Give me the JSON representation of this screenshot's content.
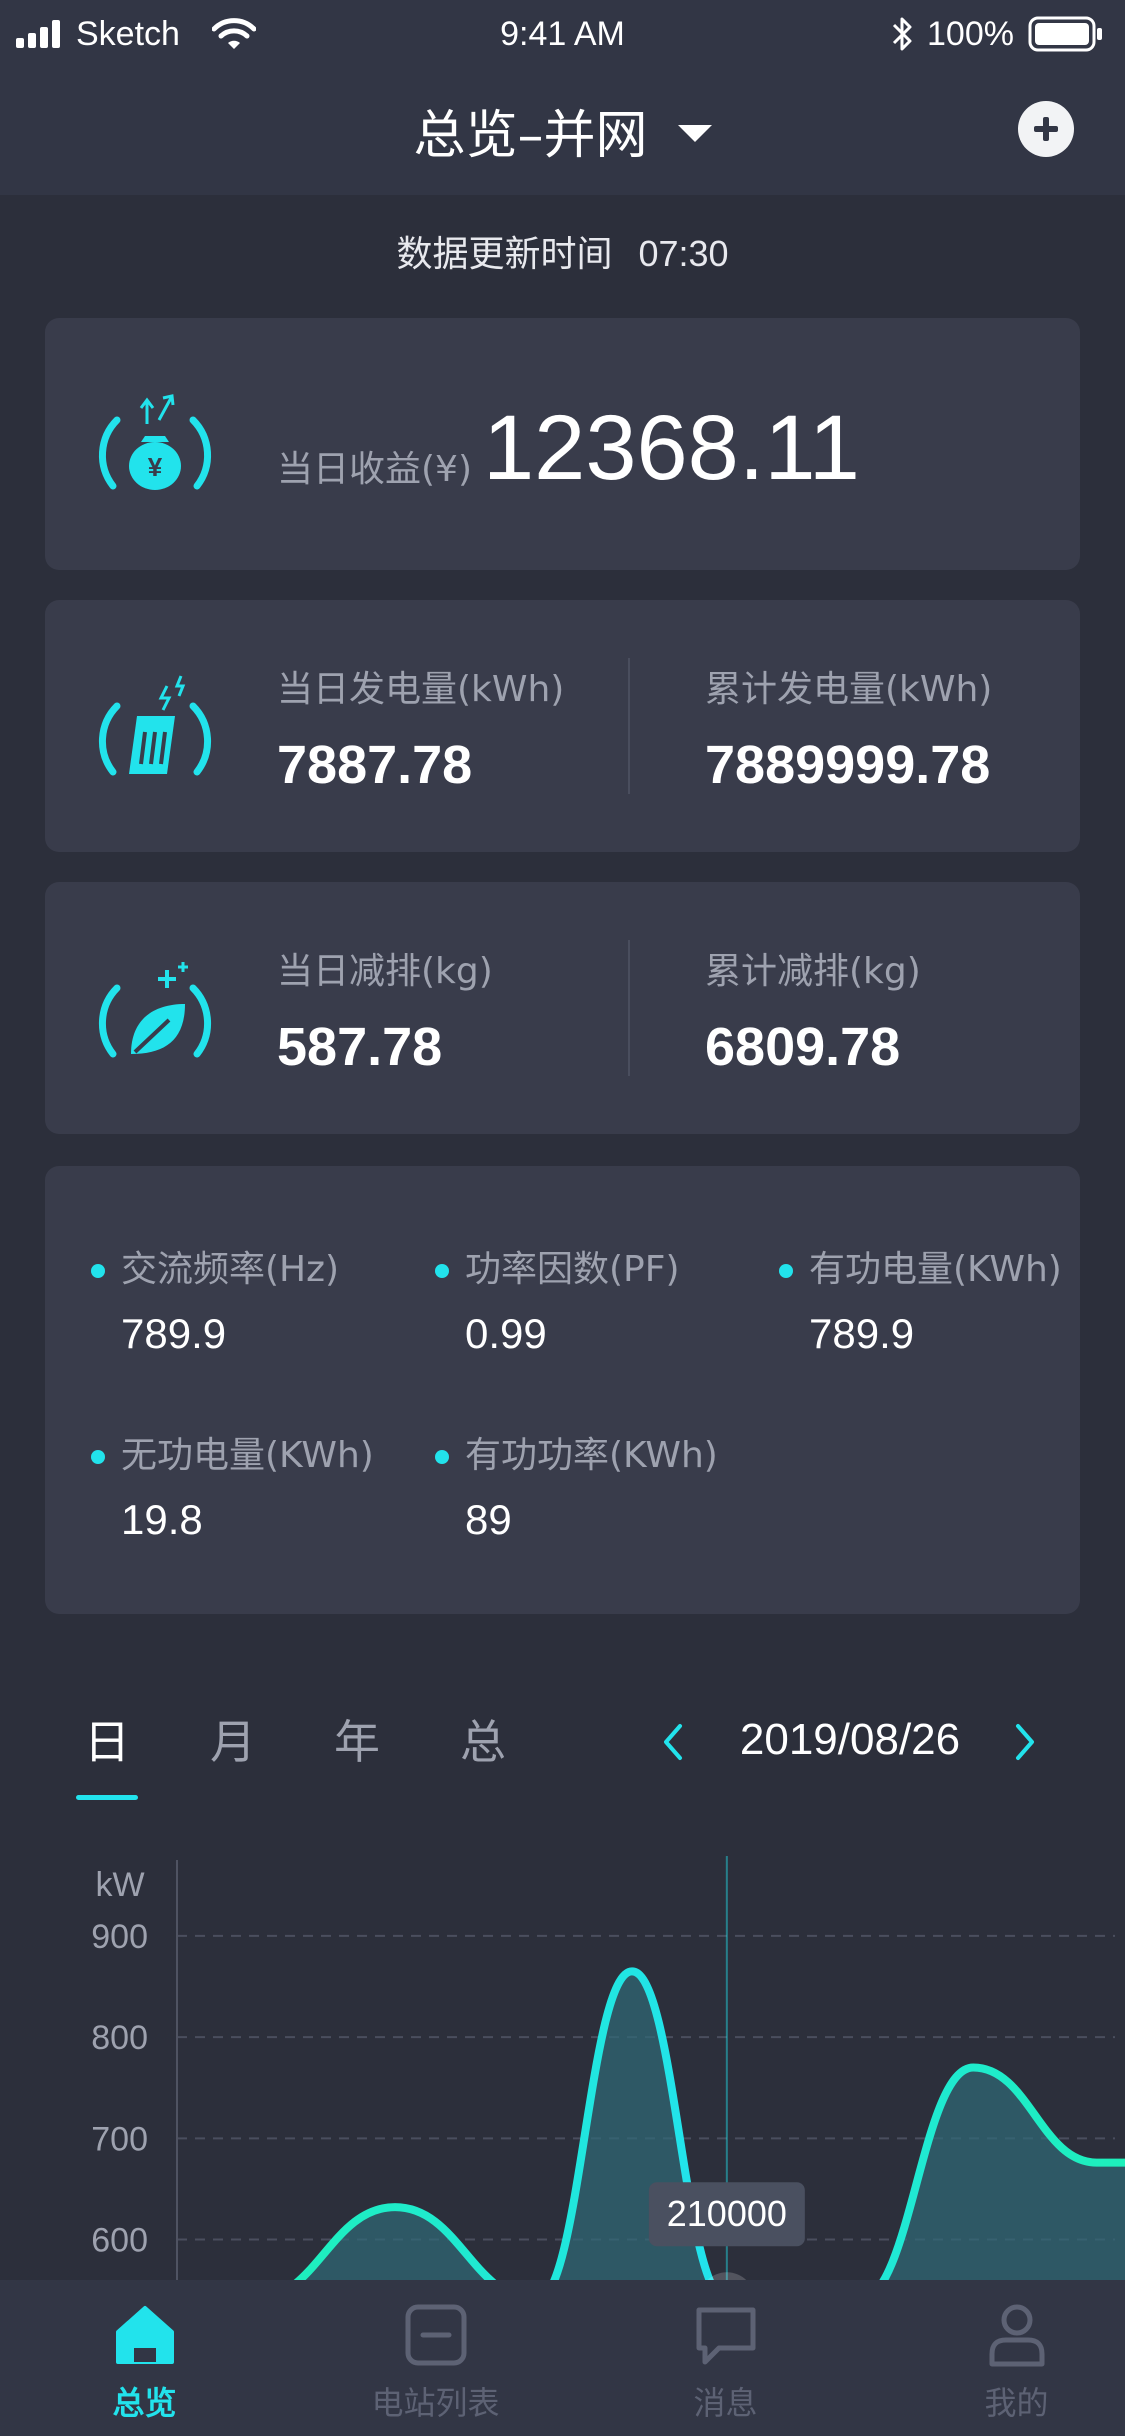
{
  "status_bar": {
    "carrier": "Sketch",
    "time": "9:41 AM",
    "battery": "100%"
  },
  "header": {
    "title": "总览–并网",
    "add_icon": "plus-circle-icon",
    "dropdown_icon": "caret-down-icon"
  },
  "update": {
    "label": "数据更新时间",
    "time": "07:30"
  },
  "income": {
    "label": "当日收益(¥)",
    "value": "12368.11",
    "icon": "money-bag-gauge-icon"
  },
  "generation": {
    "icon": "solar-panel-gauge-icon",
    "today_label": "当日发电量(kWh)",
    "today_value": "7887.78",
    "total_label": "累计发电量(kWh)",
    "total_value": "7889999.78"
  },
  "emission": {
    "icon": "leaf-gauge-icon",
    "today_label": "当日减排(kg)",
    "today_value": "587.78",
    "total_label": "累计减排(kg)",
    "total_value": "6809.78"
  },
  "metrics": [
    {
      "label": "交流频率(Hz)",
      "value": "789.9"
    },
    {
      "label": "功率因数(PF)",
      "value": "0.99"
    },
    {
      "label": "有功电量(KWh)",
      "value": "789.9"
    },
    {
      "label": "无功电量(KWh)",
      "value": "19.8"
    },
    {
      "label": "有功功率(KWh)",
      "value": "89"
    }
  ],
  "period_tabs": {
    "items": [
      "日",
      "月",
      "年",
      "总"
    ],
    "active": "日"
  },
  "date_nav": {
    "date": "2019/08/26",
    "prev_icon": "chevron-left-icon",
    "next_icon": "chevron-right-icon"
  },
  "chart_data": {
    "type": "area",
    "ylabel": "kW",
    "y_ticks": [
      "900",
      "800",
      "700",
      "600"
    ],
    "ylim": [
      560,
      975
    ],
    "grid": true,
    "tooltip": "210000",
    "line_color": "#22e3ec",
    "series": [
      {
        "points": [
          [
            0.08,
            540
          ],
          [
            0.23,
            632
          ],
          [
            0.38,
            540
          ],
          [
            0.48,
            865
          ],
          [
            0.58,
            540
          ],
          [
            0.72,
            540
          ],
          [
            0.84,
            770
          ],
          [
            0.97,
            676
          ],
          [
            1.02,
            676
          ]
        ]
      }
    ],
    "highlight_index": 4
  },
  "tabbar": {
    "items": [
      {
        "label": "总览",
        "icon": "home-icon"
      },
      {
        "label": "电站列表",
        "icon": "station-list-icon"
      },
      {
        "label": "消息",
        "icon": "message-icon"
      },
      {
        "label": "我的",
        "icon": "user-icon"
      }
    ],
    "active_index": 0
  },
  "colors": {
    "background": "#2c2f3b",
    "card": "#393c4b",
    "accent": "#22e3ec",
    "muted_text": "#9ea2af"
  }
}
